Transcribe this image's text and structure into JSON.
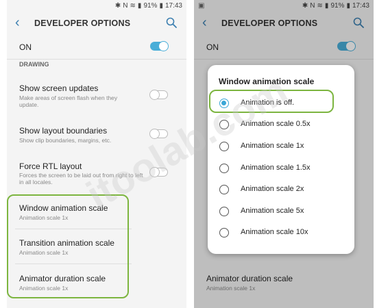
{
  "status_bar": {
    "battery": "91%",
    "time": "17:43"
  },
  "app_bar": {
    "title": "DEVELOPER OPTIONS"
  },
  "master_switch": {
    "label": "ON",
    "state": "on"
  },
  "section_header": "DRAWING",
  "settings": [
    {
      "title": "Show screen updates",
      "summary": "Make areas of screen flash when they update.",
      "toggle": "off"
    },
    {
      "title": "Show layout boundaries",
      "summary": "Show clip boundaries, margins, etc.",
      "toggle": "off"
    },
    {
      "title": "Force RTL layout",
      "summary": "Forces the screen to be laid out from right to left in all locales.",
      "toggle": "off"
    },
    {
      "title": "Window animation scale",
      "summary": "Animation scale 1x"
    },
    {
      "title": "Transition animation scale",
      "summary": "Animation scale 1x"
    },
    {
      "title": "Animator duration scale",
      "summary": "Animation scale 1x"
    }
  ],
  "dialog": {
    "title": "Window animation scale",
    "options": [
      "Animation is off.",
      "Animation scale 0.5x",
      "Animation scale 1x",
      "Animation scale 1.5x",
      "Animation scale 2x",
      "Animation scale 5x",
      "Animation scale 10x"
    ],
    "selected_index": 0
  },
  "watermark": "itoolab.com",
  "colors": {
    "accent": "#3aa6d6",
    "highlight": "#7cb53f",
    "back_arrow": "#3c7fb0"
  }
}
